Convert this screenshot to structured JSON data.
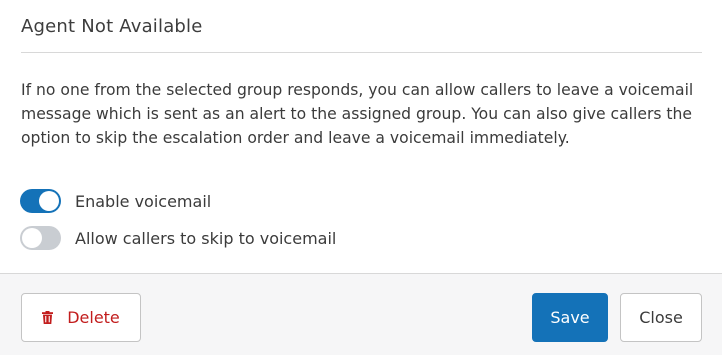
{
  "dialog": {
    "title": "Agent Not Available",
    "description": "If no one from the selected group responds, you can allow callers to leave a voicemail message which is sent as an alert to the assigned group. You can also give callers the option to skip the escalation order and leave a voicemail immediately.",
    "toggles": [
      {
        "label": "Enable voicemail",
        "state": "on"
      },
      {
        "label": "Allow callers to skip to voicemail",
        "state": "off"
      }
    ]
  },
  "footer": {
    "delete_label": "Delete",
    "save_label": "Save",
    "close_label": "Close"
  },
  "colors": {
    "accent": "#1472b8",
    "danger": "#c21d1d",
    "toggle_off": "#c9cdd2"
  },
  "icons": {
    "delete": "trash-icon"
  }
}
